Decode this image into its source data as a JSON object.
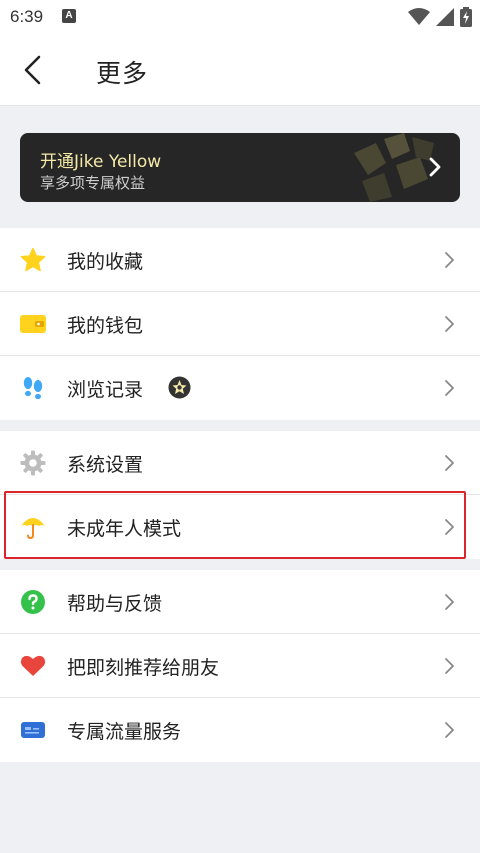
{
  "status_bar": {
    "time": "6:39",
    "notification_icon": "A"
  },
  "header": {
    "title": "更多"
  },
  "banner": {
    "title": "开通Jike Yellow",
    "subtitle": "享多项专属权益"
  },
  "group1": [
    {
      "label": "我的收藏",
      "icon": "star-icon"
    },
    {
      "label": "我的钱包",
      "icon": "wallet-icon"
    },
    {
      "label": "浏览记录",
      "icon": "footprints-icon"
    }
  ],
  "group2": [
    {
      "label": "系统设置",
      "icon": "gear-icon"
    },
    {
      "label": "未成年人模式",
      "icon": "umbrella-icon"
    }
  ],
  "group3": [
    {
      "label": "帮助与反馈",
      "icon": "question-icon"
    },
    {
      "label": "把即刻推荐给朋友",
      "icon": "heart-icon"
    },
    {
      "label": "专属流量服务",
      "icon": "sim-card-icon"
    }
  ],
  "colors": {
    "accent_yellow": "#ffd21e",
    "highlight_red": "#d9252b",
    "banner_bg": "#262626"
  }
}
